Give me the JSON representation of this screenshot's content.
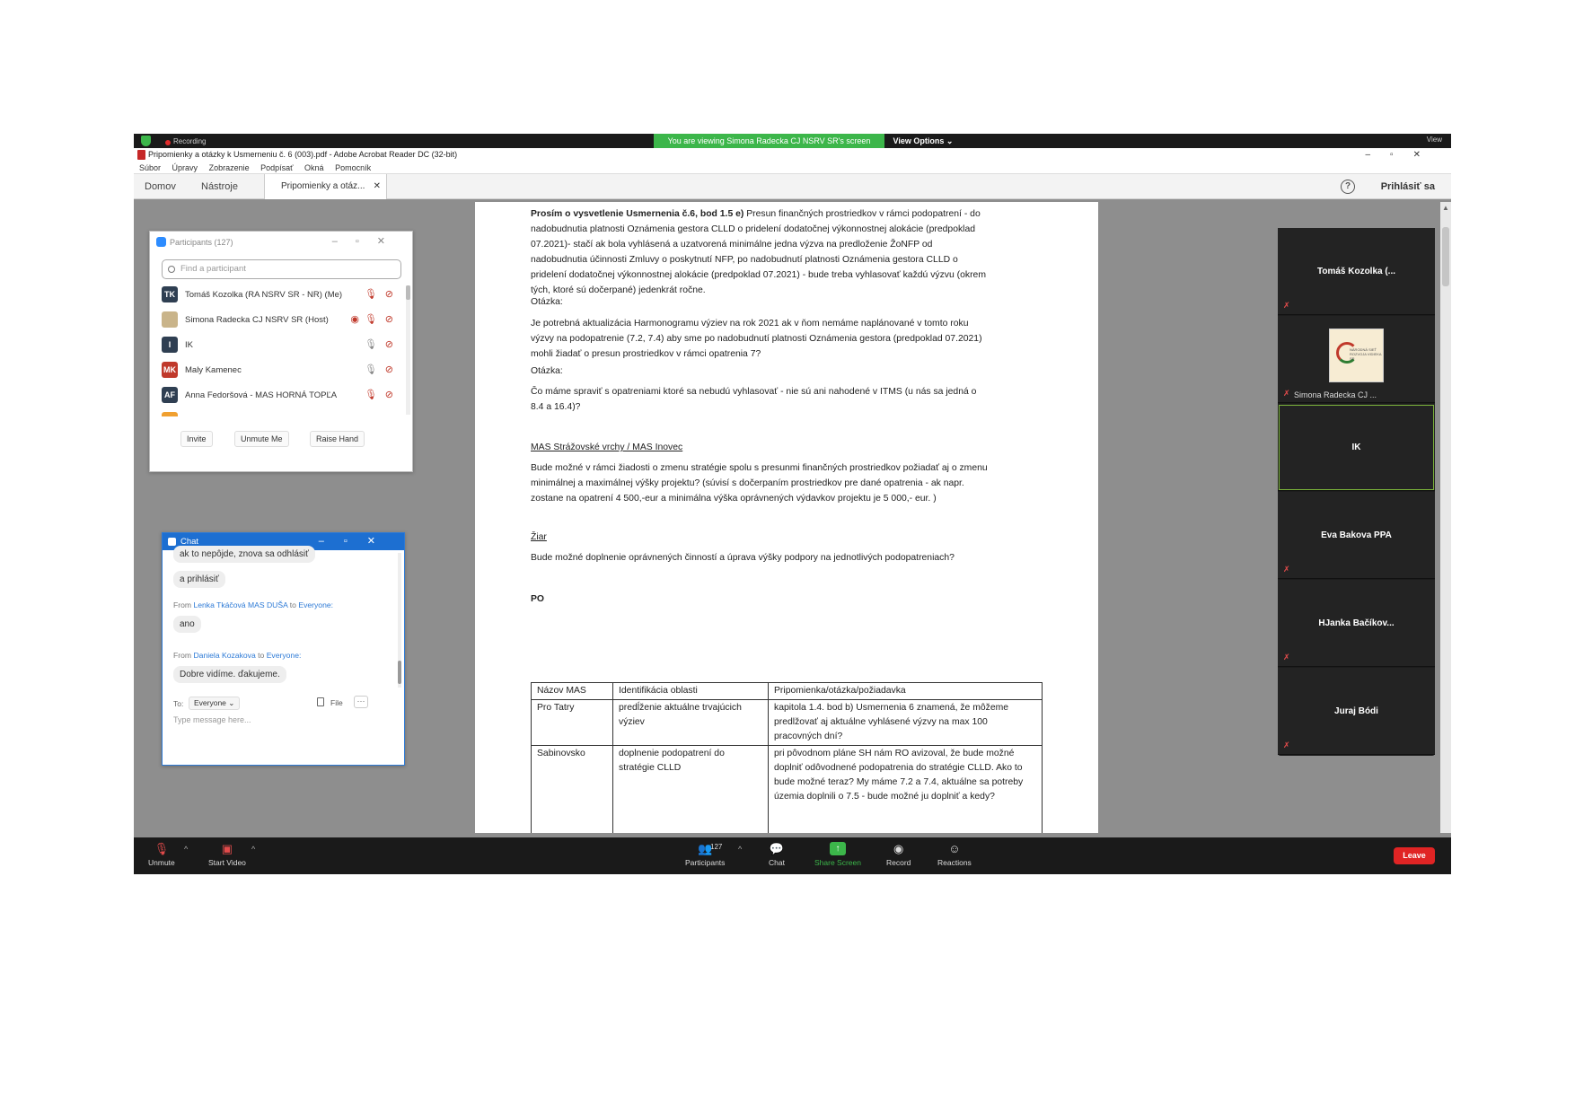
{
  "zoom": {
    "recording_label": "Recording",
    "viewing_banner": "You are viewing Simona Radecka CJ NSRV SR's screen",
    "view_options": "View Options ⌄",
    "view_label": "View"
  },
  "acrobat": {
    "window_title": "Pripomienky a otázky k Usmerneniu č. 6 (003).pdf - Adobe Acrobat Reader DC (32-bit)",
    "menu": [
      "Súbor",
      "Úpravy",
      "Zobrazenie",
      "Podpísať",
      "Okná",
      "Pomocník"
    ],
    "nav_home": "Domov",
    "nav_tools": "Nástroje",
    "doc_tab": "Pripomienky a otáz...",
    "sign_in": "Prihlásiť sa"
  },
  "document": {
    "p1_bold": "Prosím o vysvetlenie Usmernenia č.6, bod 1.5 e)",
    "p1_text": " Presun finančných prostriedkov v rámci podopatrení - do nadobudnutia platnosti Oznámenia gestora CLLD o pridelení dodatočnej výkonnostnej alokácie (predpoklad 07.2021)- stačí ak bola vyhlásená a uzatvorená minimálne jedna výzva na predloženie ŽoNFP od nadobudnutia účinnosti Zmluvy o poskytnutí NFP, po nadobudnutí platnosti Oznámenia gestora CLLD o pridelení dodatočnej výkonnostnej alokácie (predpoklad 07.2021) - bude treba vyhlasovať každú výzvu (okrem tých, ktoré sú dočerpané) jedenkrát ročne.",
    "q1_label": "Otázka:",
    "q1_text": "Je potrebná aktualizácia Harmonogramu výziev na rok 2021 ak v ňom nemáme naplánované v tomto roku výzvy na podopatrenie (7.2, 7.4) aby sme po nadobudnutí platnosti Oznámenia gestora (predpoklad 07.2021) mohli žiadať o presun prostriedkov v rámci opatrenia 7?",
    "q2_label": "Otázka:",
    "q2_text": "Čo máme spraviť s opatreniami ktoré sa nebudú vyhlasovať - nie sú ani nahodené v ITMS (u nás sa jedná o 8.4 a 16.4)?",
    "h_mas": "MAS Strážovské vrchy / MAS Inovec",
    "p_mas": "Bude možné v rámci žiadosti o zmenu stratégie spolu s presunmi finančných prostriedkov požiadať aj o zmenu minimálnej a maximálnej výšky projektu? (súvisí s dočerpaním prostriedkov pre dané opatrenia - ak napr. zostane na opatrení 4 500,-eur a minimálna výška oprávnených výdavkov projektu je 5 000,- eur. )",
    "h_ziar": "Žiar",
    "p_ziar": "Bude možné doplnenie oprávnených činností a úprava výšky podpory na jednotlivých podopatreniach?",
    "h_po": "PO",
    "table": {
      "headers": [
        "Názov MAS",
        "Identifikácia oblasti",
        "Pripomienka/otázka/požiadavka"
      ],
      "rows": [
        [
          "Pro Tatry",
          "predĺženie aktuálne trvajúcich výziev",
          "kapitola 1.4. bod b) Usmernenia 6 znamená, že môžeme predlžovať aj aktuálne vyhlásené výzvy na max 100 pracovných dní?"
        ],
        [
          "Sabinovsko",
          "doplnenie podopatrení do stratégie CLLD",
          "pri pôvodnom pláne SH nám RO avizoval, že bude možné doplniť odôvodnené podopatrenia do stratégie CLLD. Ako to bude možné teraz? My máme 7.2 a 7.4, aktuálne sa potreby územia doplnili o 7.5 - bude možné ju doplniť a kedy?"
        ]
      ]
    }
  },
  "participants": {
    "title": "Participants (127)",
    "search_placeholder": "Find a participant",
    "list": [
      {
        "initials": "TK",
        "name": "Tomáš Kozolka (RA NSRV SR - NR) (Me)",
        "color": "#2f3f52"
      },
      {
        "initials": "",
        "name": "Simona Radecka CJ NSRV SR (Host)",
        "color": "#c9b48a"
      },
      {
        "initials": "I",
        "name": "IK",
        "color": "#2f3f52"
      },
      {
        "initials": "MK",
        "name": "Maly Kamenec",
        "color": "#c0392b"
      },
      {
        "initials": "AF",
        "name": "Anna Fedoršová - MAS HORNÁ TOPĽA",
        "color": "#2f3f52"
      }
    ],
    "invite": "Invite",
    "unmute_me": "Unmute Me",
    "raise_hand": "Raise Hand"
  },
  "chat": {
    "title": "Chat",
    "partial_msg": "ak to nepôjde, znova sa odhlásiť",
    "msg1": "a prihlásiť",
    "from_prefix": "From",
    "to_suffix": "to",
    "everyone": "Everyone:",
    "sender2": "Lenka Tkáčová MAS DUŠA",
    "msg2": "ano",
    "sender3": "Daniela Kozakova",
    "msg3": "Dobre vidíme. ďakujeme.",
    "to_label": "To:",
    "to_value": "Everyone ⌄",
    "file_label": "File",
    "input_placeholder": "Type message here..."
  },
  "gallery": {
    "tiles": [
      "Tomáš Kozolka (...",
      "Simona Radecka CJ ...",
      "IK",
      "Eva Bakova PPA",
      "HJanka  Bačíkov...",
      "Juraj Bódi"
    ],
    "logo_text": "NÁRODNÁ SIEŤ ROZVOJA VIDIEKA SR"
  },
  "toolbar": {
    "unmute": "Unmute",
    "start_video": "Start Video",
    "participants": "Participants",
    "participant_count": "127",
    "chat": "Chat",
    "share_screen": "Share Screen",
    "record": "Record",
    "reactions": "Reactions",
    "leave": "Leave"
  },
  "colors": {
    "zoom_green": "#3cb64a",
    "leave_red": "#e02424",
    "chat_blue": "#1d6fd1"
  }
}
